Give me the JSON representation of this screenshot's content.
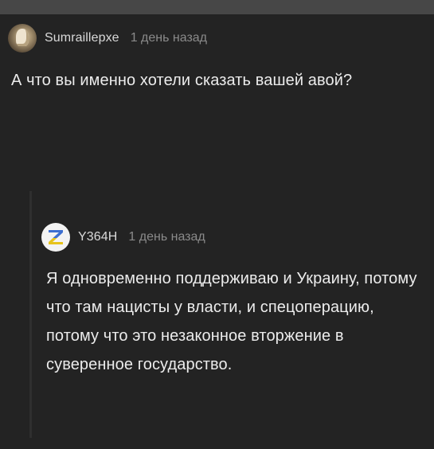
{
  "comments": [
    {
      "author": "Sumraillepxe",
      "time": "1 день назад",
      "text": "А что вы именно хотели сказать вашей авой?"
    },
    {
      "author": "Y364H",
      "time": "1 день назад",
      "avatar_letter": "Z",
      "text": "Я одновременно поддерживаю и Украину, потому что там нацисты у власти, и спецоперацию, потому что это незаконное вторжение в суверенное государство."
    }
  ],
  "colors": {
    "background": "#232323",
    "top_strip": "#474747",
    "author": "#d9d9d9",
    "timestamp": "#8a8a8a",
    "text": "#ececec",
    "z_blue": "#3d6fd0",
    "z_yellow": "#e7c31b"
  }
}
